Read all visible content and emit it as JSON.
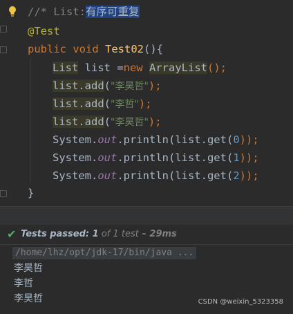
{
  "editor": {
    "comment_prefix": "//* List:",
    "comment_selected": "有序可重复",
    "annotation": "@Test",
    "method_kw1": "public",
    "method_kw2": "void",
    "method_name": "Test02",
    "method_tail": "(){",
    "decl_type": "List",
    "decl_var": " list =",
    "decl_new": "new",
    "decl_class": "ArrayList",
    "decl_tail": "();",
    "add_target": "list.add",
    "add_values": [
      "\"李昊哲\"",
      "\"李哲\"",
      "\"李昊哲\""
    ],
    "add_tail": ");",
    "print_prefix": "System.",
    "print_field": "out",
    "print_call": ".println(list.get(",
    "print_indices": [
      "0",
      "1",
      "2"
    ],
    "print_tail": "));",
    "closing_brace": "}"
  },
  "run": {
    "status_prefix": "Tests passed: ",
    "passed": "1",
    "of_text": " of 1 test",
    "duration": " – 29ms",
    "command": "/home/lhz/opt/jdk-17/bin/java ...",
    "output_lines": [
      "李昊哲",
      "李哲",
      "李昊哲"
    ]
  },
  "watermark": "CSDN @weixin_5323358",
  "colors": {
    "background": "#2b2b2b",
    "keyword": "#cc7832",
    "string": "#6a8759",
    "method": "#ffc66d",
    "field": "#9876aa",
    "number": "#6897bb",
    "selection": "#214283",
    "passed_check": "#59a869"
  }
}
